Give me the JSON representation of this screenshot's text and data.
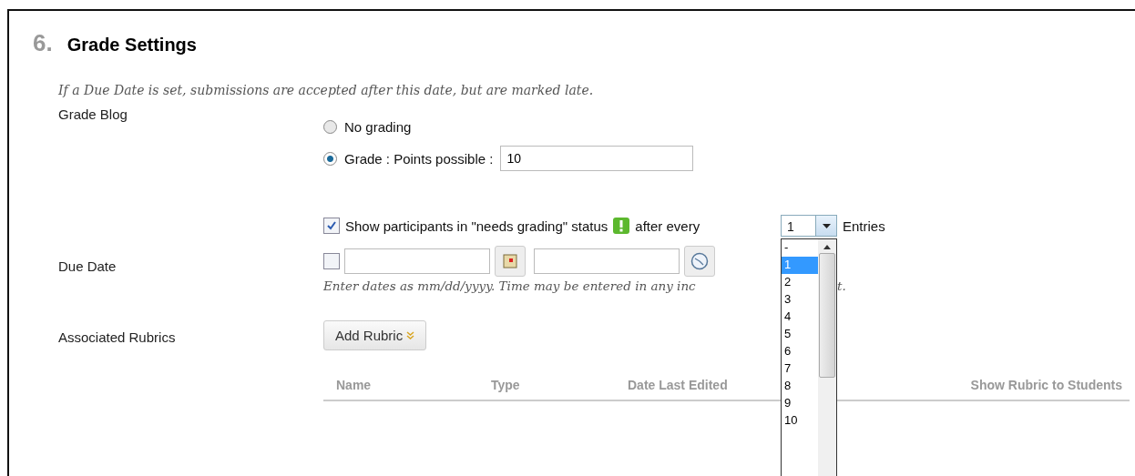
{
  "section": {
    "number": "6.",
    "title": "Grade Settings"
  },
  "note": "If a Due Date is set, submissions are accepted after this date, but are marked late.",
  "grade_blog": {
    "label": "Grade Blog",
    "options": [
      {
        "label": "No grading",
        "selected": false
      },
      {
        "label": "Grade : Points possible :",
        "selected": true
      }
    ],
    "points_value": "10"
  },
  "needs_grading": {
    "checked": true,
    "label": "Show participants in \"needs grading\" status",
    "after_label": "after every",
    "select_value": "1",
    "entries_label": "Entries",
    "dropdown_items": [
      {
        "label": "-",
        "selected": false
      },
      {
        "label": "1",
        "selected": true
      },
      {
        "label": "2",
        "selected": false
      },
      {
        "label": "3",
        "selected": false
      },
      {
        "label": "4",
        "selected": false
      },
      {
        "label": "5",
        "selected": false
      },
      {
        "label": "6",
        "selected": false
      },
      {
        "label": "7",
        "selected": false
      },
      {
        "label": "8",
        "selected": false
      },
      {
        "label": "9",
        "selected": false
      },
      {
        "label": "10",
        "selected": false
      }
    ]
  },
  "due_date": {
    "label": "Due Date",
    "checked": false,
    "hint_start": "Enter dates as mm/dd/yyyy. Time may be entered in any inc",
    "hint_end": "t."
  },
  "rubrics": {
    "label": "Associated Rubrics",
    "button": "Add Rubric",
    "columns": [
      "Name",
      "Type",
      "Date Last Edited",
      "Show Rubric to Students"
    ]
  }
}
